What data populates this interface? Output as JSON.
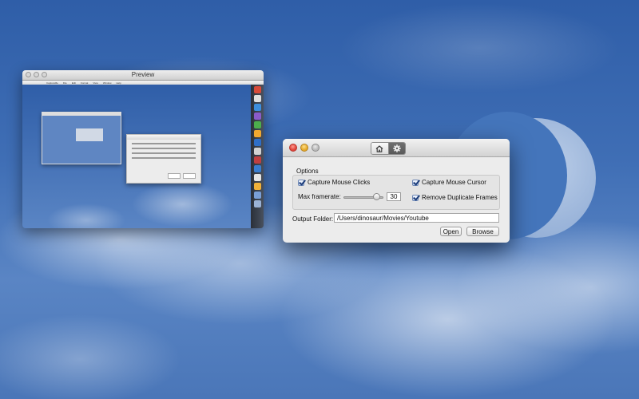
{
  "preview_window": {
    "title": "Preview",
    "menu": [
      "CaptureMe",
      "File",
      "Edit",
      "Format",
      "View",
      "Window",
      "Help"
    ]
  },
  "prefs_window": {
    "toolbar": {
      "home_icon": "house-icon",
      "settings_icon": "gear-icon",
      "selected": "settings"
    },
    "options": {
      "group_label": "Options",
      "capture_mouse_clicks": {
        "label": "Capture Mouse Clicks",
        "checked": true
      },
      "capture_mouse_cursor": {
        "label": "Capture Mouse Cursor",
        "checked": true
      },
      "max_framerate": {
        "label": "Max framerate:",
        "value": "30"
      },
      "remove_duplicate_frames": {
        "label": "Remove Duplicate Frames",
        "checked": true
      }
    },
    "output_folder": {
      "label": "Output Folder:",
      "value": "/Users/dinosaur/Movies/Youtube"
    },
    "buttons": {
      "open": "Open",
      "browse": "Browse"
    }
  }
}
